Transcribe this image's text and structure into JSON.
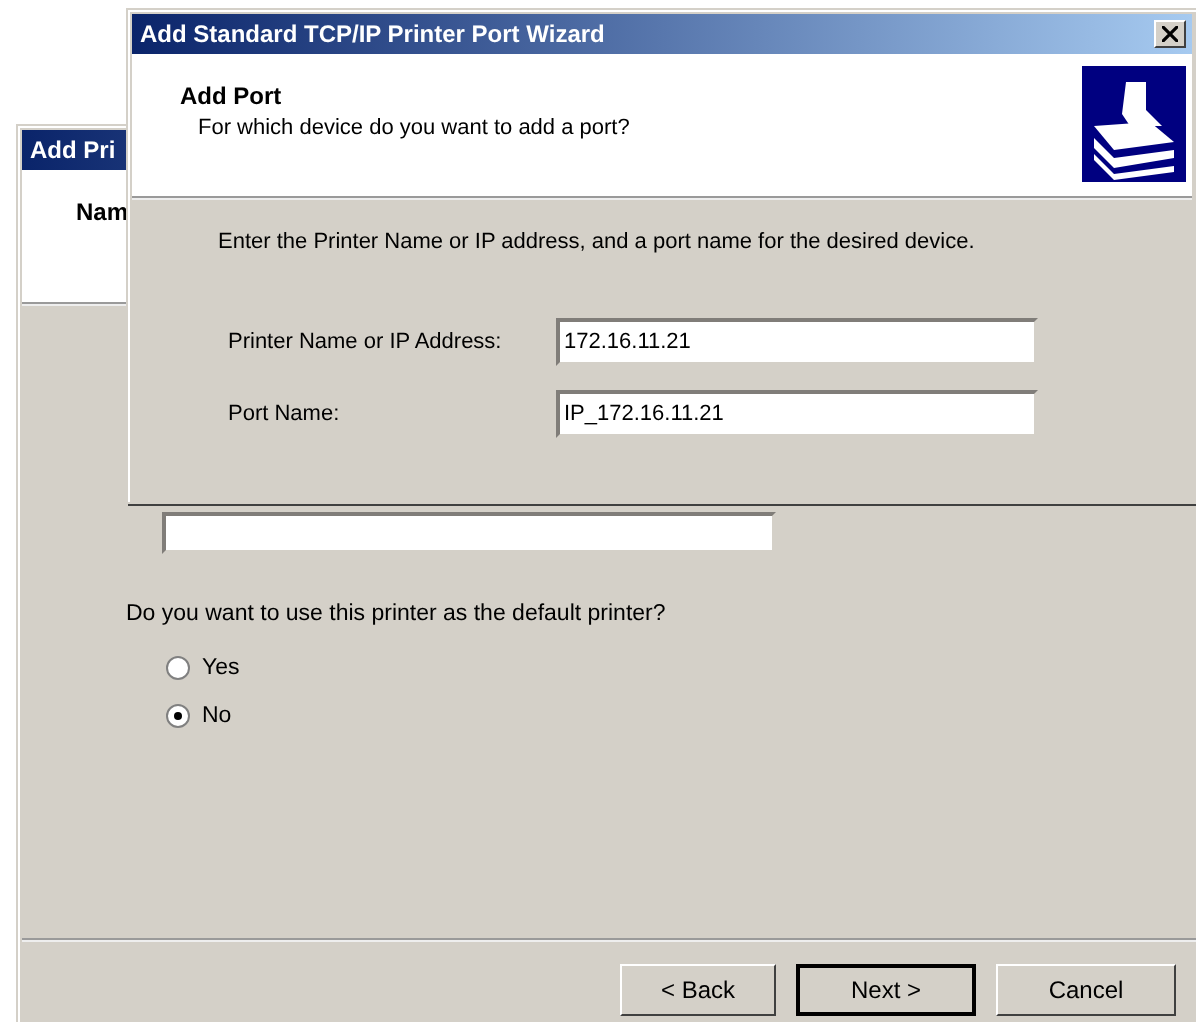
{
  "background_window": {
    "title": "Add Pri",
    "header_title": "Nam",
    "question": "Do you want to use this printer as the default printer?",
    "options": [
      {
        "label": "Yes",
        "selected": false
      },
      {
        "label": "No",
        "selected": true
      }
    ],
    "buttons": [
      {
        "label": "< Back",
        "default": false
      },
      {
        "label": "Next >",
        "default": true
      },
      {
        "label": "Cancel",
        "default": false
      }
    ]
  },
  "dialog": {
    "title": "Add Standard TCP/IP Printer Port Wizard",
    "header_title": "Add Port",
    "header_subtitle": "For which device do you want to add a port?",
    "instruction": "Enter the Printer Name or IP address, and a port name for the desired device.",
    "fields": [
      {
        "label": "Printer Name or IP Address:",
        "value": "172.16.11.21"
      },
      {
        "label": "Port Name:",
        "value": "IP_172.16.11.21"
      }
    ]
  }
}
